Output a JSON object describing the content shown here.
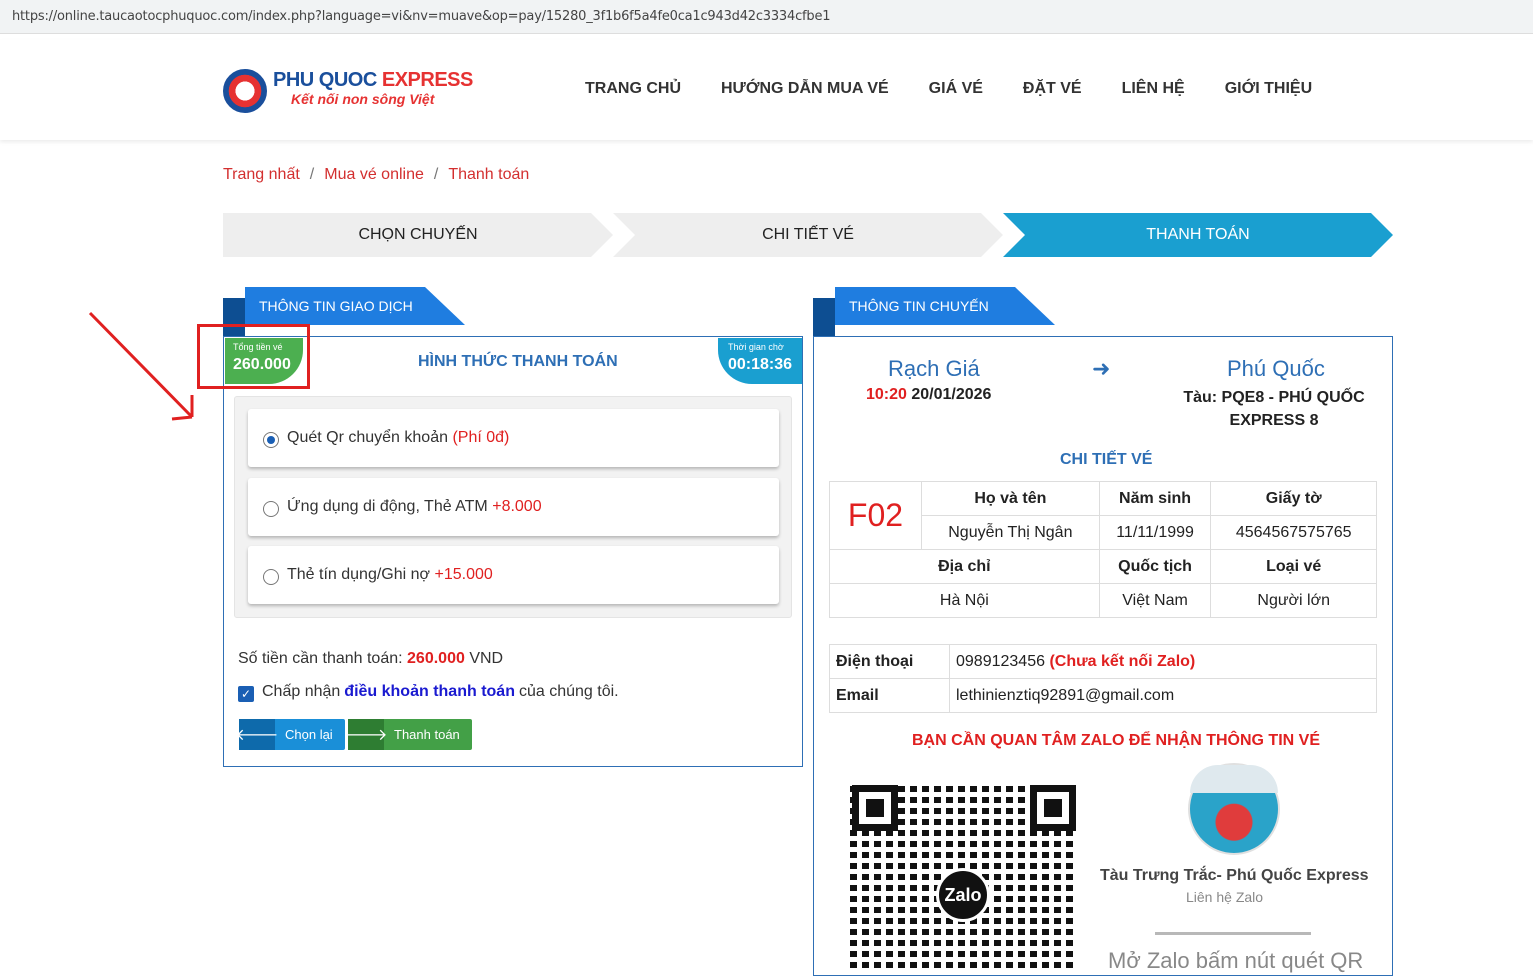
{
  "browser": {
    "url": "https://online.taucaotocphuquoc.com/index.php?language=vi&nv=muave&op=pay/15280_3f1b6f5a4fe0ca1c943d42c3334cfbe1"
  },
  "brand": {
    "title_part1": "PHU QUOC",
    "title_part2": "EXPRESS",
    "slogan": "Kết nối non sông Việt",
    "logo_text": "QQE"
  },
  "nav": [
    "TRANG CHỦ",
    "HƯỚNG DẪN MUA VÉ",
    "GIÁ VÉ",
    "ĐẶT VÉ",
    "LIÊN HỆ",
    "GIỚI THIỆU"
  ],
  "breadcrumb": [
    "Trang nhất",
    "Mua vé online",
    "Thanh toán"
  ],
  "breadcrumb_sep": "/",
  "steps": [
    "CHỌN CHUYẾN",
    "CHI TIẾT VÉ",
    "THANH TOÁN"
  ],
  "transaction": {
    "box_title": "THÔNG TIN GIAO DỊCH",
    "total_label": "Tổng tiền vé",
    "total_value": "260.000",
    "timer_label": "Thời gian chờ",
    "timer_value": "00:18:36",
    "methods_heading": "HÌNH THỨC THANH TOÁN",
    "methods": [
      {
        "label": "Quét Qr chuyển khoản",
        "fee": "(Phí 0đ)",
        "selected": true
      },
      {
        "label": "Ứng dụng di động, Thẻ ATM",
        "fee": "+8.000",
        "selected": false
      },
      {
        "label": "Thẻ tín dụng/Ghi nợ",
        "fee": "+15.000",
        "selected": false
      }
    ],
    "amount_label": "Số tiền cần thanh toán:",
    "amount_value": "260.000",
    "amount_currency": "VND",
    "accept_prefix": "Chấp nhận",
    "accept_link": "điều khoản thanh toán",
    "accept_suffix": "của chúng tôi.",
    "accept_checked": true,
    "back_label": "Chọn lại",
    "pay_label": "Thanh toán"
  },
  "trip": {
    "box_title": "THÔNG TIN CHUYẾN",
    "from": "Rạch Giá",
    "to": "Phú Quốc",
    "time": "10:20",
    "date": "20/01/2026",
    "ship": "Tàu: PQE8 - PHÚ QUỐC EXPRESS 8",
    "ticket_heading": "CHI TIẾT VÉ",
    "seat": "F02",
    "headers1": [
      "Họ và tên",
      "Năm sinh",
      "Giấy tờ"
    ],
    "row1": [
      "Nguyễn Thị Ngân",
      "11/11/1999",
      "4564567575765"
    ],
    "headers2": [
      "Địa chỉ",
      "Quốc tịch",
      "Loại vé"
    ],
    "row2": [
      "Hà Nội",
      "Việt Nam",
      "Người lớn"
    ],
    "phone_label": "Điện thoại",
    "phone_value": "0989123456",
    "phone_note": "(Chưa kết nối Zalo)",
    "email_label": "Email",
    "email_value": "lethinienztiq92891@gmail.com",
    "zalo_note": "BẠN CẦN QUAN TÂM ZALO ĐỂ NHẬN THÔNG TIN VÉ",
    "zalo_logo": "Zalo",
    "zalo_name": "Tàu Trưng Trắc- Phú Quốc Express",
    "zalo_contact": "Liên hệ Zalo",
    "zalo_hint": "Mở Zalo bấm nút quét QR"
  },
  "colors": {
    "accent_blue": "#1f7de0",
    "step_active": "#1a9fd0",
    "price_red": "#e02020",
    "badge_green": "#4caf50"
  }
}
